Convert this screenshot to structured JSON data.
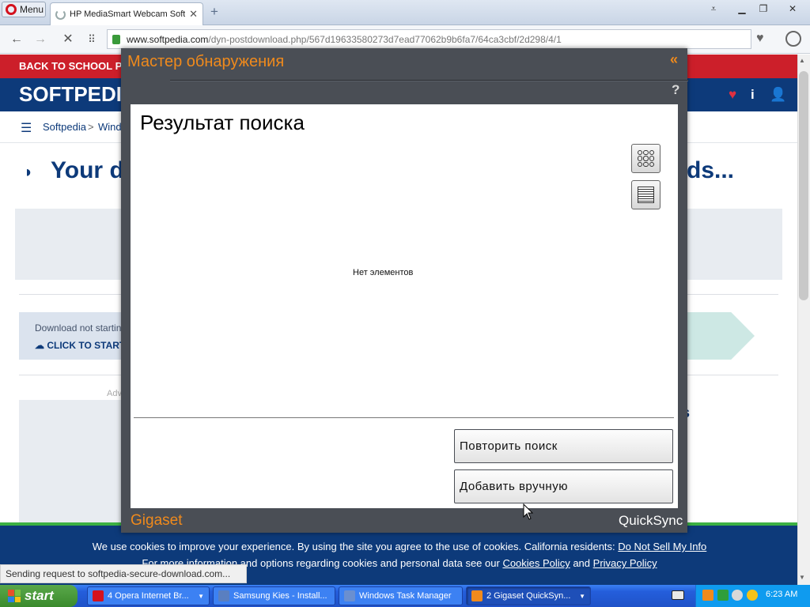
{
  "browser": {
    "menu_label": "Menu",
    "tab_title": "HP MediaSmart Webcam Soft",
    "tab_close": "✕",
    "new_tab": "+",
    "url_domain": "www.softpedia.com",
    "url_path": "/dyn-postdownload.php/567d19633580273d7ead77062b9b6fa7/64ca3cbf/2d298/4/1",
    "status_text": "Sending request to softpedia-secure-download.com..."
  },
  "page": {
    "promo": "BACK TO SCHOOL PRO",
    "brand": "SOFTPEDIA",
    "breadcrumb_home": "Softpedia",
    "breadcrumb_sep": ">",
    "breadcrumb_section": "Wind",
    "headline_left": "Your d",
    "headline_right": "ds...",
    "download_not_starting": "Download not startin",
    "click_to_start": "CLICK TO START I",
    "adv_label": "Adv",
    "right_fragment": "s",
    "cookie_text_1": "We use cookies to improve your experience. By using the site you agree to the use of cookies. California residents:",
    "cookie_link_1": "Do Not Sell My Info",
    "cookie_text_2": "For more information and options regarding cookies and personal data see our",
    "cookie_link_2": "Cookies Policy",
    "cookie_and": "and",
    "cookie_link_3": "Privacy Policy"
  },
  "dialog": {
    "title": "Мастер обнаружения",
    "collapse": "«",
    "help": "?",
    "panel_title": "Результат поиска",
    "empty_message": "Нет элементов",
    "retry_button": "Повторить поиск",
    "add_manual_button": "Добавить вручную",
    "brand": "Gigaset",
    "product": "QuickSync"
  },
  "taskbar": {
    "start_label": "start",
    "tasks": [
      {
        "label": "4 Opera Internet Br...",
        "icon_color": "#d4121e",
        "has_group": true,
        "active": false
      },
      {
        "label": "Samsung Kies - Install...",
        "icon_color": "#5a7fc0",
        "has_group": false,
        "active": false
      },
      {
        "label": "Windows Task Manager",
        "icon_color": "#6a8fd0",
        "has_group": false,
        "active": false
      },
      {
        "label": "2 Gigaset QuickSyn...",
        "icon_color": "#f08a1c",
        "has_group": true,
        "active": true
      }
    ],
    "clock": "6:23 AM"
  },
  "colors": {
    "softpedia_blue": "#0d3a7a",
    "promo_red": "#cc1f2a",
    "gigaset_orange": "#f08a1c",
    "dialog_frame": "#4a4e55",
    "xp_blue": "#245edb"
  }
}
